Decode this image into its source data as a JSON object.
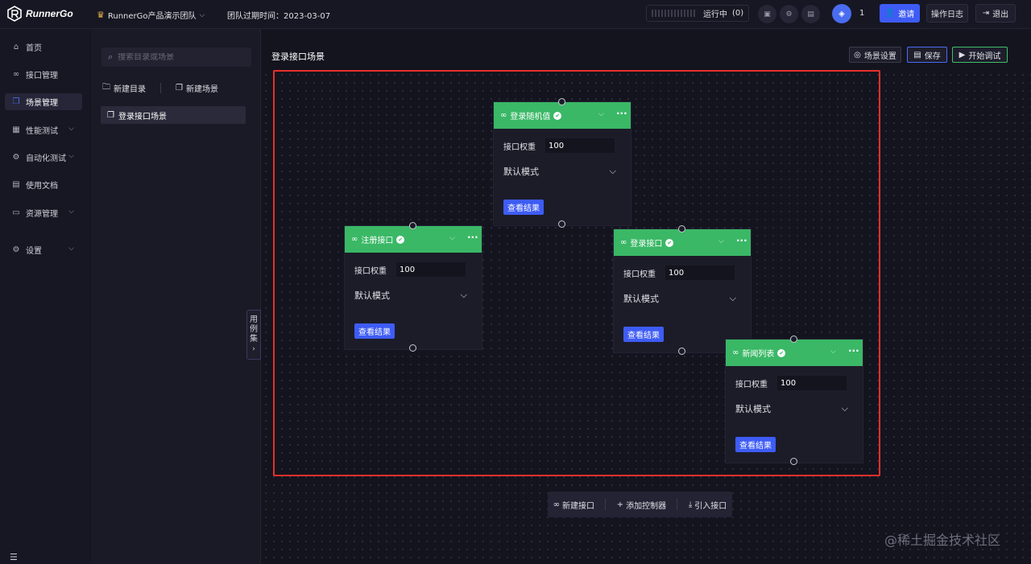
{
  "header": {
    "logo_text": "RunnerGo",
    "team_name": "RunnerGo产品演示团队",
    "expire": "团队过期时间：2023-03-07",
    "running_label": "运行中",
    "running_count": "(0)",
    "user_count": "1",
    "invite_label": "邀请",
    "oplog_label": "操作日志",
    "logout_label": "退出"
  },
  "sidebar": {
    "items": [
      {
        "label": "首页",
        "icon": "home-icon"
      },
      {
        "label": "接口管理",
        "icon": "link-icon"
      },
      {
        "label": "场景管理",
        "icon": "scene-icon"
      },
      {
        "label": "性能测试",
        "icon": "chart-icon"
      },
      {
        "label": "自动化测试",
        "icon": "auto-test-icon"
      },
      {
        "label": "使用文档",
        "icon": "doc-icon"
      },
      {
        "label": "资源管理",
        "icon": "monitor-icon"
      },
      {
        "label": "设置",
        "icon": "gear-icon"
      }
    ]
  },
  "tree": {
    "search_placeholder": "搜索目录或场景",
    "new_folder": "新建目录",
    "new_scene": "新建场景",
    "scene_item": "登录接口场景",
    "side_tab": [
      "用",
      "例",
      "集"
    ]
  },
  "main": {
    "title": "登录接口场景",
    "scene_settings": "场景设置",
    "save": "保存",
    "start_debug": "开始调试"
  },
  "nodes": [
    {
      "name": "登录随机值",
      "weight_label": "接口权重",
      "weight": "100",
      "mode": "默认模式",
      "result_btn": "查看结果"
    },
    {
      "name": "注册接口",
      "weight_label": "接口权重",
      "weight": "100",
      "mode": "默认模式",
      "result_btn": "查看结果"
    },
    {
      "name": "登录接口",
      "weight_label": "接口权重",
      "weight": "100",
      "mode": "默认模式",
      "result_btn": "查看结果"
    },
    {
      "name": "新闻列表",
      "weight_label": "接口权重",
      "weight": "100",
      "mode": "默认模式",
      "result_btn": "查看结果"
    }
  ],
  "bottom_toolbar": {
    "new_api": "新建接口",
    "add_controller": "添加控制器",
    "import_api": "引入接口"
  },
  "watermark": "@稀土掘金技术社区",
  "colors": {
    "accent": "#3e5cf5",
    "node_header": "#3ab866",
    "highlight": "#e8302c",
    "background": "#14141f"
  }
}
